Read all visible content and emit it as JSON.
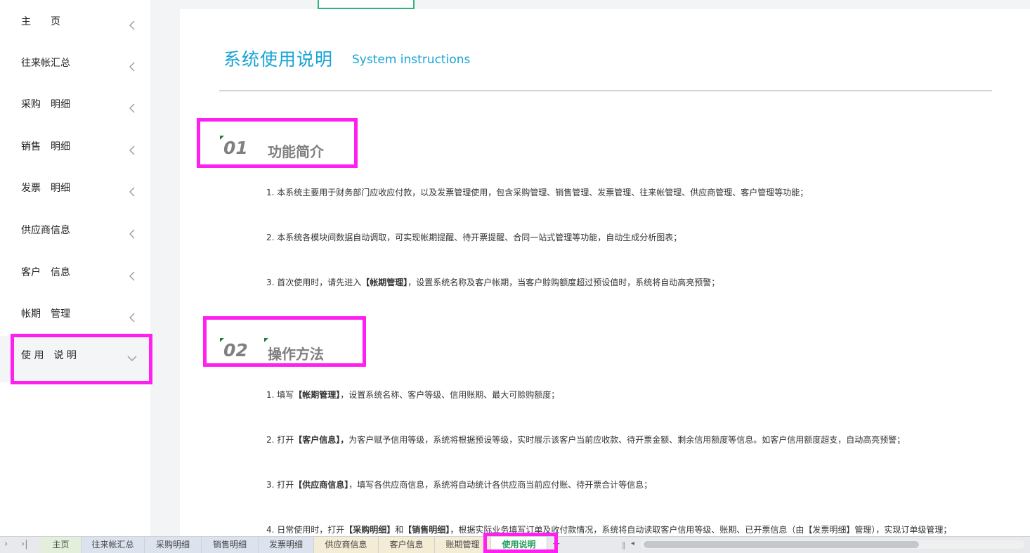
{
  "sidebar": {
    "items": [
      {
        "label": "主　　页"
      },
      {
        "label": "往来帐汇总"
      },
      {
        "label": "采购　明细"
      },
      {
        "label": "销售　明细"
      },
      {
        "label": "发票　明细"
      },
      {
        "label": "供应商信息"
      },
      {
        "label": "客户　信息"
      },
      {
        "label": "帐期　管理"
      },
      {
        "label": "使 用　说 明"
      }
    ]
  },
  "content": {
    "title_cn": "系统使用说明",
    "title_en": "System instructions",
    "section1": {
      "num": "01",
      "title": "功能简介",
      "items": [
        {
          "text": "1. 本系统主要用于财务部门应收应付款，以及发票管理使用，包含采购管理、销售管理、发票管理、往来帐管理、供应商管理、客户管理等功能；"
        },
        {
          "text": "2. 本系统各模块间数据自动调取，可实现帐期提醒、待开票提醒、合同一站式管理等功能，自动生成分析图表；"
        },
        {
          "pre": "3. 首次使用时，请先进入",
          "bold": "【帐期管理】",
          "post": "，设置系统名称及客户帐期，当客户赊购额度超过预设值时，系统将自动高亮预警；"
        }
      ]
    },
    "section2": {
      "num": "02",
      "title": "操作方法",
      "items": [
        {
          "pre": "1. 填写",
          "bold": "【帐期管理】",
          "post": "，设置系统名称、客户等级、信用账期、最大可赊购额度；"
        },
        {
          "pre": "2. 打开",
          "bold": "【客户信息】，",
          "post": "为客户赋予信用等级，系统将根据预设等级，实时展示该客户当前应收款、待开票金额、剩余信用额度等信息。如客户信用额度超支，自动高亮预警；"
        },
        {
          "pre": "3. 打开",
          "bold": "【供应商信息】",
          "post": "，填写各供应商信息，系统将自动统计各供应商当前应付账、待开票合计等信息；"
        },
        {
          "pre": "4. 日常使用时，打开",
          "bold": "【采购明细】",
          "mid": "和",
          "bold2": "【销售明细】",
          "post": "，根据实际业务填写订单及收付款情况，系统将自动读取客户信用等级、账期、已开票信息（由【发票明细】管理），实现订单级管理；"
        }
      ]
    }
  },
  "tabs": [
    {
      "label": "主页",
      "color": "#e4efdb"
    },
    {
      "label": "往来帐汇总",
      "color": "#dde3ee"
    },
    {
      "label": "采购明细",
      "color": "#dde3ee"
    },
    {
      "label": "销售明细",
      "color": "#dde3ee"
    },
    {
      "label": "发票明细",
      "color": "#dde3ee"
    },
    {
      "label": "供应商信息",
      "color": "#f5ecd5"
    },
    {
      "label": "客户信息",
      "color": "#f5ecd5"
    },
    {
      "label": "账期管理",
      "color": "#f5ecd5"
    },
    {
      "label": "使用说明",
      "color": "#ffffff"
    }
  ],
  "tabbar": {
    "nav_next": "›",
    "nav_last": "›|",
    "add": "+",
    "sep": "‖",
    "scroll_left": "◂"
  },
  "colors": {
    "accent": "#18a3d6",
    "highlight": "#ff1ff0",
    "active_tab": "#1e9e5a"
  }
}
